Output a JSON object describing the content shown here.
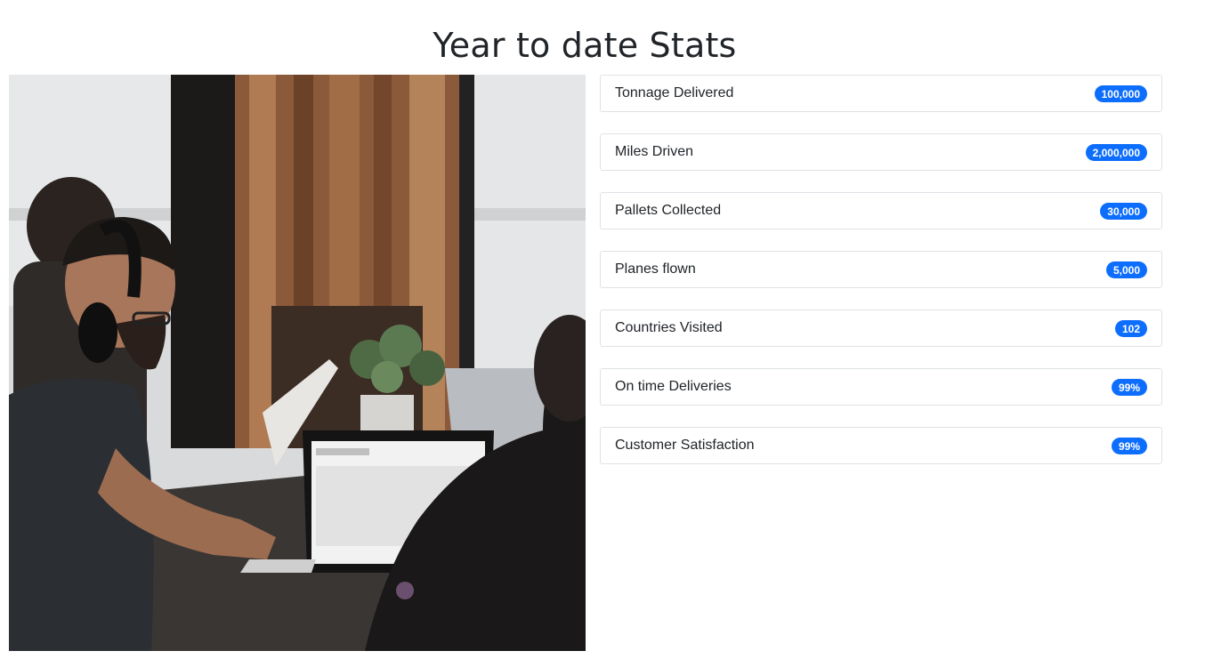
{
  "page": {
    "title": "Year to date Stats"
  },
  "image": {
    "icon": "office-photo"
  },
  "stats": [
    {
      "label": "Tonnage Delivered",
      "value": "100,000"
    },
    {
      "label": "Miles Driven",
      "value": "2,000,000"
    },
    {
      "label": "Pallets Collected",
      "value": "30,000"
    },
    {
      "label": "Planes flown",
      "value": "5,000"
    },
    {
      "label": "Countries Visited",
      "value": "102"
    },
    {
      "label": "On time Deliveries",
      "value": "99%"
    },
    {
      "label": "Customer Satisfaction",
      "value": "99%"
    }
  ],
  "colors": {
    "badge": "#0d6efd",
    "border": "#dee2e6",
    "text": "#212529"
  }
}
